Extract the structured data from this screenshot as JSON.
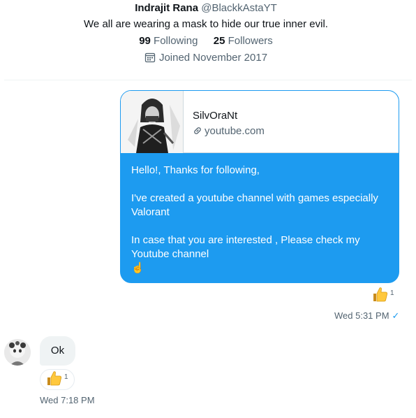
{
  "profile": {
    "name": "Indrajit Rana",
    "handle": "@BlackkAstaYT",
    "bio": "We all are wearing a mask to hide our true inner evil.",
    "following_count": "99",
    "following_label": "Following",
    "followers_count": "25",
    "followers_label": "Followers",
    "joined": "Joined November 2017"
  },
  "link_card": {
    "title": "SilvOraNt",
    "url": "youtube.com"
  },
  "outgoing_message": {
    "lines": [
      "Hello!, Thanks for following,",
      "I've created a youtube channel with games  especially Valorant",
      "In case that you are interested , Please check  my Youtube channel"
    ],
    "emoji": "☝️",
    "reaction_emoji": "👍",
    "reaction_count": "1",
    "timestamp": "Wed 5:31 PM",
    "status_icon": "✓"
  },
  "incoming_message": {
    "text": "Ok",
    "reaction_emoji": "👍",
    "reaction_count": "1",
    "timestamp": "Wed 7:18 PM"
  },
  "colors": {
    "accent": "#1d9bf0",
    "muted": "#536471",
    "text": "#0f1419"
  }
}
